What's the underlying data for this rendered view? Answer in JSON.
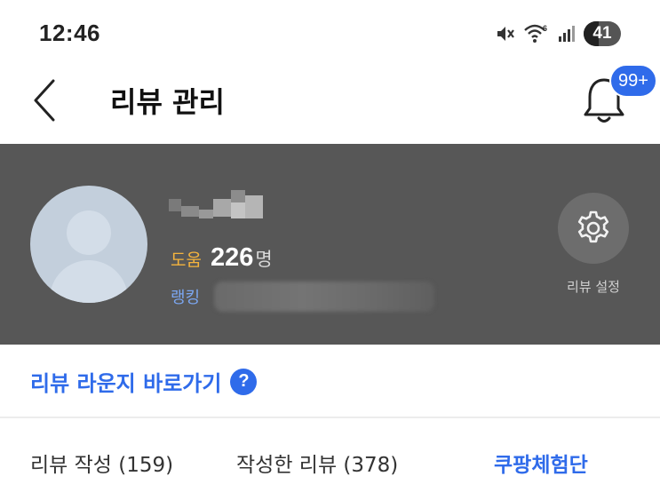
{
  "status_bar": {
    "time": "12:46",
    "battery_level": "41",
    "battery_fraction": 0.41,
    "icons": [
      "mute-icon",
      "wifi-icon",
      "signal-icon",
      "battery-icon"
    ]
  },
  "header": {
    "title": "리뷰 관리",
    "notification_badge": "99+"
  },
  "profile": {
    "help_label": "도움",
    "help_count": "226",
    "help_unit": "명",
    "rank_label": "랭킹",
    "settings_label": "리뷰 설정"
  },
  "lounge": {
    "label": "리뷰 라운지 바로가기",
    "help_glyph": "?"
  },
  "tabs": [
    {
      "label": "리뷰 작성 (159)"
    },
    {
      "label": "작성한 리뷰 (378)"
    },
    {
      "label": "쿠팡체험단"
    }
  ],
  "colors": {
    "accent": "#2f6bea",
    "panel_bg": "#575757",
    "help_label": "#f5b43d",
    "rank_label": "#7ba6f0"
  }
}
